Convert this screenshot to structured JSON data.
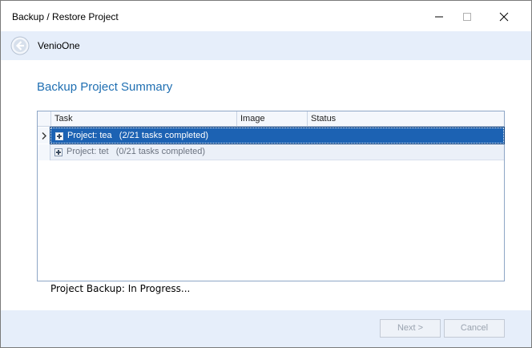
{
  "window": {
    "title": "Backup / Restore Project"
  },
  "nav": {
    "title": "VenioOne"
  },
  "summary": {
    "title": "Backup Project Summary"
  },
  "grid": {
    "columns": [
      "Task",
      "Image",
      "Status"
    ],
    "rows": [
      {
        "label": "Project: tea   (2/21 tasks completed)",
        "selected": true
      },
      {
        "label": "Project: tet   (0/21 tasks completed)",
        "selected": false
      }
    ]
  },
  "status": {
    "text": "Project Backup: In Progress..."
  },
  "footer": {
    "next_label": "Next >",
    "cancel_label": "Cancel"
  },
  "colors": {
    "accent": "#1f6fb2",
    "selection": "#1c62b3",
    "panel": "#e6eefa"
  }
}
